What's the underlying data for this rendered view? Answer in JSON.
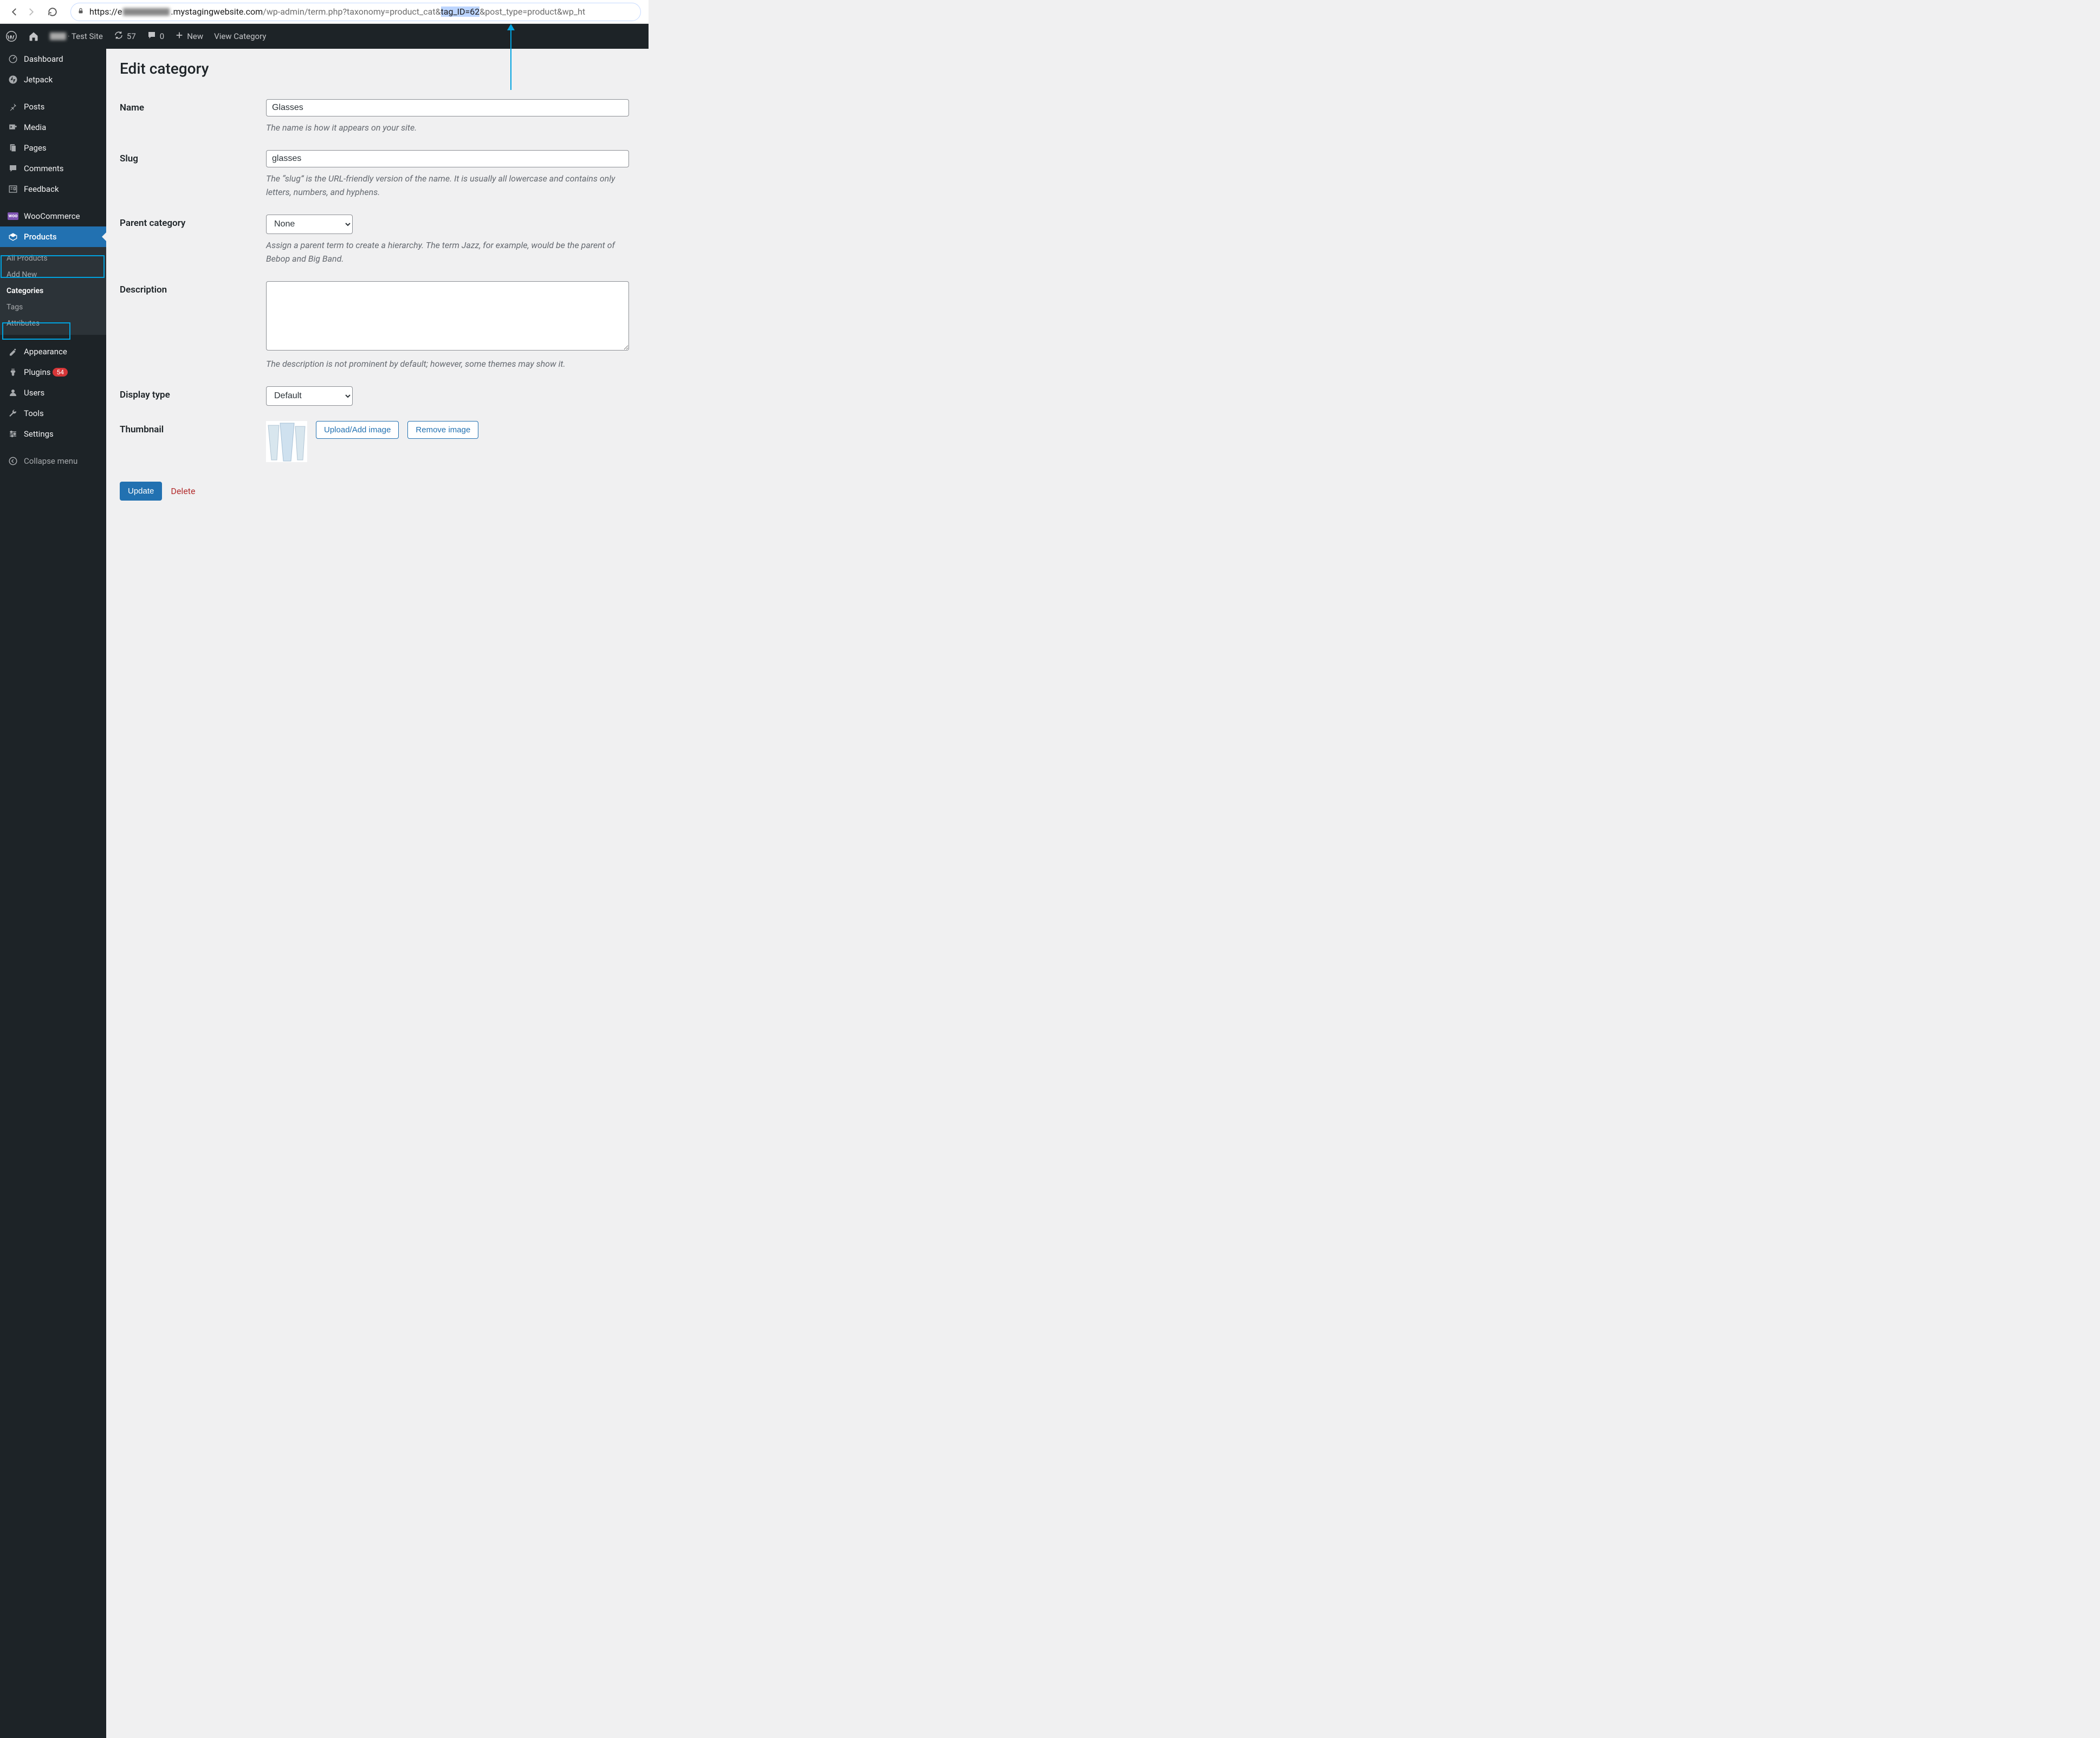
{
  "browser": {
    "url_prefix": "https://",
    "url_host": ".mystagingwebsite.com",
    "url_path": "/wp-admin/term.php?taxonomy=product_cat&",
    "url_highlight": "tag_ID=62",
    "url_rest": "&post_type=product&wp_ht"
  },
  "adminbar": {
    "site_name": "Test Site",
    "updates": "57",
    "comments": "0",
    "new_label": "New",
    "view_label": "View Category"
  },
  "sidebar": {
    "items": [
      {
        "label": "Dashboard"
      },
      {
        "label": "Jetpack"
      },
      {
        "label": "Posts"
      },
      {
        "label": "Media"
      },
      {
        "label": "Pages"
      },
      {
        "label": "Comments"
      },
      {
        "label": "Feedback"
      },
      {
        "label": "WooCommerce"
      },
      {
        "label": "Products"
      },
      {
        "label": "Appearance"
      },
      {
        "label": "Plugins",
        "badge": "54"
      },
      {
        "label": "Users"
      },
      {
        "label": "Tools"
      },
      {
        "label": "Settings"
      },
      {
        "label": "Collapse menu"
      }
    ],
    "submenu": [
      {
        "label": "All Products"
      },
      {
        "label": "Add New"
      },
      {
        "label": "Categories"
      },
      {
        "label": "Tags"
      },
      {
        "label": "Attributes"
      }
    ]
  },
  "content": {
    "heading": "Edit category",
    "fields": {
      "name": {
        "label": "Name",
        "value": "Glasses",
        "help": "The name is how it appears on your site."
      },
      "slug": {
        "label": "Slug",
        "value": "glasses",
        "help": "The “slug” is the URL-friendly version of the name. It is usually all lowercase and contains only letters, numbers, and hyphens."
      },
      "parent": {
        "label": "Parent category",
        "value": "None",
        "help": "Assign a parent term to create a hierarchy. The term Jazz, for example, would be the parent of Bebop and Big Band."
      },
      "description": {
        "label": "Description",
        "value": "",
        "help": "The description is not prominent by default; however, some themes may show it."
      },
      "display": {
        "label": "Display type",
        "value": "Default"
      },
      "thumbnail": {
        "label": "Thumbnail",
        "upload": "Upload/Add image",
        "remove": "Remove image"
      }
    },
    "submit": {
      "update": "Update",
      "delete": "Delete"
    }
  }
}
